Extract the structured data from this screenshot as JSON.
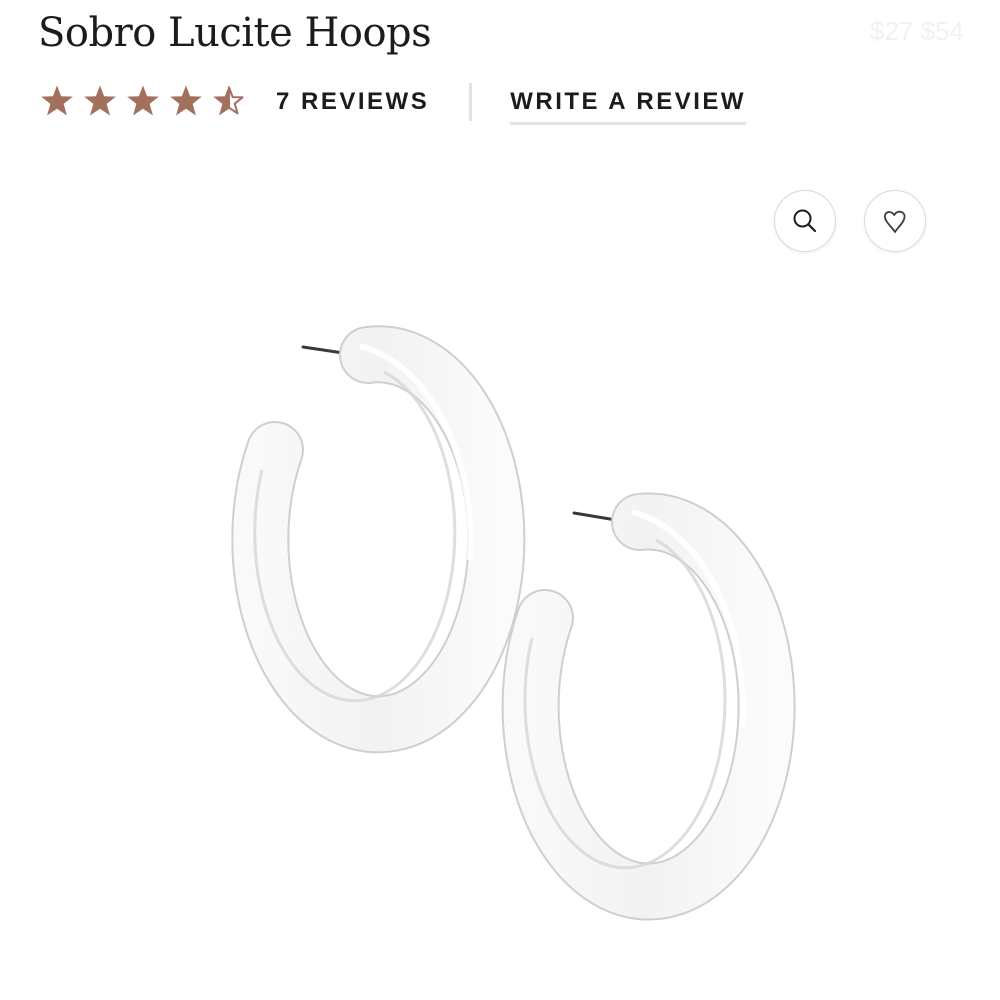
{
  "product": {
    "title": "Sobro Lucite Hoops",
    "price": "$27 $54"
  },
  "rating": {
    "value": 4.5,
    "max": 5,
    "star_color": "#a4705e",
    "reviews_label": "7 REVIEWS",
    "write_review_label": "WRITE A REVIEW"
  },
  "image_controls": {
    "zoom_icon": "search-icon",
    "wishlist_icon": "heart-icon"
  },
  "image": {
    "subject": "clear lucite hoop earrings"
  }
}
